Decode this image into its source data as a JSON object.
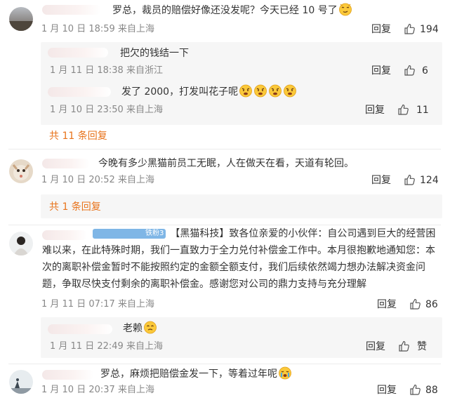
{
  "comments": [
    {
      "text": "罗总，裁员的赔偿好像还没发呢？今天已经 10 号了",
      "emoji": "smirk-face-emoji",
      "time": "1 月 10 日 18:59",
      "location": "来自上海",
      "reply_label": "回复",
      "likes": "194",
      "replies": [
        {
          "text": "把欠的钱结一下",
          "time": "1 月 11 日 18:38",
          "location": "来自浙江",
          "reply_label": "回复",
          "likes": "6"
        },
        {
          "text": "发了 2000，打发叫花子呢",
          "time": "1 月 10 日 23:50",
          "location": "来自上海",
          "reply_label": "回复",
          "likes": "11"
        }
      ],
      "more_label": "共 11 条回复"
    },
    {
      "text": "今晚有多少黑猫前员工无眠，人在做天在看，天道有轮回。",
      "time": "1 月 10 日 20:52",
      "location": "来自上海",
      "reply_label": "回复",
      "likes": "124",
      "more_label": "共 1 条回复"
    },
    {
      "badge": "铁粉3",
      "text": "【黑猫科技】致各位亲爱的小伙伴：自公司遇到巨大的经营困难以来，在此特殊时期，我们一直致力于全力兑付补偿金工作中。本月很抱歉地通知您：本次的离职补偿金暂时不能按照约定的金额全额支付，我们后续依然竭力想办法解决资金问题，争取尽快支付剩余的离职补偿金。感谢您对公司的鼎力支持与充分理解",
      "time": "1 月 11 日 07:17",
      "location": "来自上海",
      "reply_label": "回复",
      "likes": "86",
      "replies": [
        {
          "text": "老赖",
          "time": "1 月 11 日 22:49",
          "location": "来自上海",
          "reply_label": "回复",
          "likes": "赞"
        }
      ]
    },
    {
      "text": "罗总，麻烦把赔偿金发一下，等着过年呢",
      "time": "1 月 10 日 20:37",
      "location": "来自上海",
      "reply_label": "回复",
      "likes": "88"
    }
  ],
  "colors": {
    "accent": "#e8731b",
    "meta": "#888888",
    "sub_bg": "#f6f6f6"
  }
}
